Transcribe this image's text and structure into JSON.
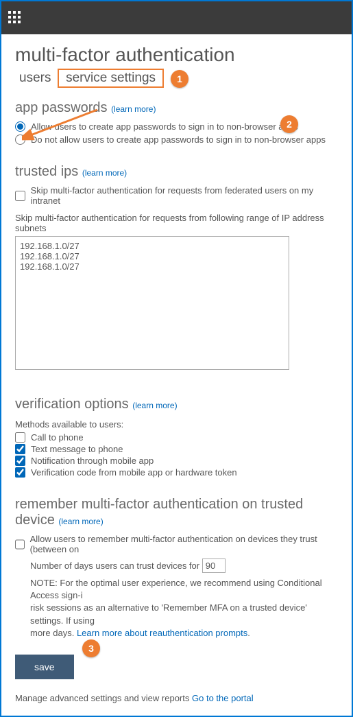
{
  "page_title": "multi-factor authentication",
  "tabs": {
    "users": "users",
    "service_settings": "service settings"
  },
  "app_passwords": {
    "heading": "app passwords",
    "learn_more": "(learn more)",
    "allow_label": "Allow users to create app passwords to sign in to non-browser apps",
    "disallow_label": "Do not allow users to create app passwords to sign in to non-browser apps"
  },
  "trusted_ips": {
    "heading": "trusted ips",
    "learn_more": "(learn more)",
    "skip_federated_label": "Skip multi-factor authentication for requests from federated users on my intranet",
    "skip_range_label": "Skip multi-factor authentication for requests from following range of IP address subnets",
    "ips_value": "192.168.1.0/27\n192.168.1.0/27\n192.168.1.0/27"
  },
  "verification": {
    "heading": "verification options",
    "learn_more": "(learn more)",
    "methods_label": "Methods available to users:",
    "call": "Call to phone",
    "text": "Text message to phone",
    "notification": "Notification through mobile app",
    "code": "Verification code from mobile app or hardware token"
  },
  "remember": {
    "heading": "remember multi-factor authentication on trusted device",
    "learn_more": "(learn more)",
    "allow_label": "Allow users to remember multi-factor authentication on devices they trust (between on",
    "days_label_prefix": "Number of days users can trust devices for",
    "days_value": "90",
    "note_prefix": "NOTE: For the optimal user experience, we recommend using Conditional Access sign-i",
    "note_mid": "risk sessions as an alternative to 'Remember MFA on a trusted device' settings. If using",
    "note_more": "more days.",
    "learn_link": "Learn more about reauthentication prompts"
  },
  "save_label": "save",
  "footer": {
    "text": "Manage advanced settings and view reports",
    "link": "Go to the portal"
  },
  "callouts": {
    "one": "1",
    "two": "2",
    "three": "3"
  }
}
